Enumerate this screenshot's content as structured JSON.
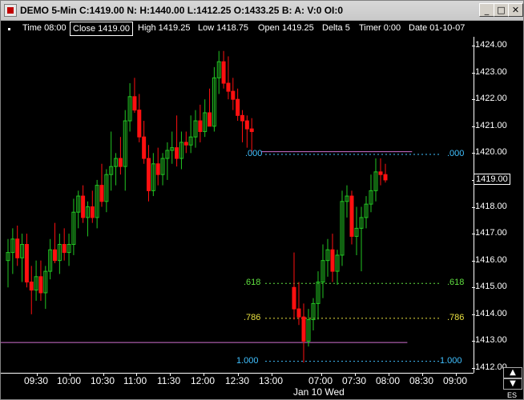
{
  "window": {
    "title": "DEMO 5-Min C:1419.00 N: H:1440.00 L:1412.25 O:1433.25 B: A: V:0 OI:0",
    "minimize": "_",
    "maximize": "□",
    "close": "✕"
  },
  "status": {
    "time": "Time 08:00",
    "close": "Close 1419.00",
    "high": "High 1419.25",
    "low": "Low 1418.75",
    "open": "Open 1419.25",
    "delta": "Delta 5",
    "timer": "Timer 0:00",
    "date": "Date 01-10-07"
  },
  "price_axis": {
    "ticks": [
      "1424.00",
      "1423.00",
      "1422.00",
      "1421.00",
      "1420.00",
      "1419.00",
      "1418.00",
      "1417.00",
      "1416.00",
      "1415.00",
      "1414.00",
      "1413.00",
      "1412.00"
    ],
    "current_price": "1419.00"
  },
  "time_axis": {
    "ticks": [
      "09:30",
      "10:00",
      "10:30",
      "11:00",
      "11:30",
      "12:00",
      "12:30",
      "13:00",
      "07:00",
      "07:30",
      "08:00",
      "08:30",
      "09:00"
    ],
    "date_label": "Jan 10 Wed",
    "symbol": "ES"
  },
  "fib": {
    "labels_left": [
      ".000",
      ".618",
      ".786",
      "1.000"
    ],
    "labels_right": [
      ".000",
      ".618",
      ".786",
      "1.000"
    ]
  },
  "colors": {
    "up": "#22c522",
    "down": "#ff1010",
    "fib0": "#40c0ff",
    "fib618": "#60e040",
    "fib786": "#e8e040",
    "fib1": "#40c0ff",
    "hline": "#d070d0"
  },
  "chart_data": {
    "type": "candlestick",
    "ylim": [
      1412,
      1424.2
    ],
    "candles": [
      {
        "o": 1416.0,
        "h": 1416.8,
        "l": 1415.0,
        "c": 1416.3
      },
      {
        "o": 1416.3,
        "h": 1417.2,
        "l": 1415.5,
        "c": 1416.8
      },
      {
        "o": 1416.8,
        "h": 1417.3,
        "l": 1415.8,
        "c": 1416.1
      },
      {
        "o": 1416.1,
        "h": 1417.0,
        "l": 1415.2,
        "c": 1416.6
      },
      {
        "o": 1416.6,
        "h": 1417.0,
        "l": 1415.0,
        "c": 1415.2
      },
      {
        "o": 1415.2,
        "h": 1415.8,
        "l": 1414.0,
        "c": 1414.9
      },
      {
        "o": 1414.9,
        "h": 1416.0,
        "l": 1414.5,
        "c": 1415.4
      },
      {
        "o": 1415.4,
        "h": 1416.0,
        "l": 1414.5,
        "c": 1414.8
      },
      {
        "o": 1414.8,
        "h": 1415.8,
        "l": 1414.2,
        "c": 1415.6
      },
      {
        "o": 1415.6,
        "h": 1416.8,
        "l": 1415.3,
        "c": 1416.4
      },
      {
        "o": 1416.4,
        "h": 1417.4,
        "l": 1415.9,
        "c": 1416.0
      },
      {
        "o": 1416.0,
        "h": 1417.0,
        "l": 1415.5,
        "c": 1416.6
      },
      {
        "o": 1416.6,
        "h": 1417.2,
        "l": 1416.0,
        "c": 1416.3
      },
      {
        "o": 1416.3,
        "h": 1417.0,
        "l": 1415.8,
        "c": 1416.6
      },
      {
        "o": 1416.6,
        "h": 1418.3,
        "l": 1416.2,
        "c": 1417.8
      },
      {
        "o": 1417.8,
        "h": 1418.6,
        "l": 1417.2,
        "c": 1418.4
      },
      {
        "o": 1418.4,
        "h": 1418.8,
        "l": 1417.4,
        "c": 1417.6
      },
      {
        "o": 1417.6,
        "h": 1418.2,
        "l": 1416.9,
        "c": 1418.0
      },
      {
        "o": 1418.0,
        "h": 1418.6,
        "l": 1417.4,
        "c": 1417.6
      },
      {
        "o": 1417.6,
        "h": 1419.0,
        "l": 1417.2,
        "c": 1418.8
      },
      {
        "o": 1418.8,
        "h": 1419.6,
        "l": 1418.0,
        "c": 1418.2
      },
      {
        "o": 1418.2,
        "h": 1419.4,
        "l": 1417.8,
        "c": 1419.2
      },
      {
        "o": 1419.2,
        "h": 1420.8,
        "l": 1418.6,
        "c": 1419.5
      },
      {
        "o": 1419.5,
        "h": 1420.0,
        "l": 1418.8,
        "c": 1419.8
      },
      {
        "o": 1419.8,
        "h": 1420.6,
        "l": 1419.2,
        "c": 1419.5
      },
      {
        "o": 1419.5,
        "h": 1421.6,
        "l": 1418.6,
        "c": 1421.2
      },
      {
        "o": 1421.2,
        "h": 1422.6,
        "l": 1420.8,
        "c": 1422.1
      },
      {
        "o": 1422.1,
        "h": 1422.8,
        "l": 1421.5,
        "c": 1421.6
      },
      {
        "o": 1421.6,
        "h": 1422.2,
        "l": 1420.4,
        "c": 1420.6
      },
      {
        "o": 1420.6,
        "h": 1421.2,
        "l": 1419.6,
        "c": 1419.8
      },
      {
        "o": 1419.8,
        "h": 1420.3,
        "l": 1418.2,
        "c": 1418.6
      },
      {
        "o": 1418.6,
        "h": 1420.0,
        "l": 1418.4,
        "c": 1419.6
      },
      {
        "o": 1419.6,
        "h": 1420.2,
        "l": 1418.8,
        "c": 1419.2
      },
      {
        "o": 1419.2,
        "h": 1420.0,
        "l": 1418.8,
        "c": 1419.8
      },
      {
        "o": 1419.8,
        "h": 1420.4,
        "l": 1419.0,
        "c": 1420.1
      },
      {
        "o": 1420.1,
        "h": 1420.8,
        "l": 1419.6,
        "c": 1420.2
      },
      {
        "o": 1420.2,
        "h": 1421.4,
        "l": 1419.5,
        "c": 1419.8
      },
      {
        "o": 1419.8,
        "h": 1420.8,
        "l": 1419.4,
        "c": 1420.4
      },
      {
        "o": 1420.4,
        "h": 1420.8,
        "l": 1420.0,
        "c": 1420.3
      },
      {
        "o": 1420.3,
        "h": 1421.4,
        "l": 1420.0,
        "c": 1420.6
      },
      {
        "o": 1420.6,
        "h": 1421.6,
        "l": 1420.2,
        "c": 1421.2
      },
      {
        "o": 1421.2,
        "h": 1421.8,
        "l": 1420.4,
        "c": 1420.8
      },
      {
        "o": 1420.8,
        "h": 1422.0,
        "l": 1420.6,
        "c": 1421.5
      },
      {
        "o": 1421.5,
        "h": 1422.4,
        "l": 1421.0,
        "c": 1421.0
      },
      {
        "o": 1421.0,
        "h": 1423.2,
        "l": 1420.8,
        "c": 1422.8
      },
      {
        "o": 1422.8,
        "h": 1423.8,
        "l": 1422.2,
        "c": 1423.4
      },
      {
        "o": 1423.4,
        "h": 1423.8,
        "l": 1422.4,
        "c": 1422.6
      },
      {
        "o": 1422.6,
        "h": 1423.6,
        "l": 1422.0,
        "c": 1422.3
      },
      {
        "o": 1422.3,
        "h": 1422.8,
        "l": 1421.6,
        "c": 1422.0
      },
      {
        "o": 1422.0,
        "h": 1422.4,
        "l": 1421.2,
        "c": 1421.4
      },
      {
        "o": 1421.4,
        "h": 1421.6,
        "l": 1420.4,
        "c": 1421.2
      },
      {
        "o": 1421.2,
        "h": 1421.4,
        "l": 1420.2,
        "c": 1420.9
      },
      {
        "o": 1420.9,
        "h": 1421.3,
        "l": 1420.0,
        "c": 1420.8
      },
      {
        "o": 1415.0,
        "h": 1416.3,
        "l": 1413.8,
        "c": 1414.2
      },
      {
        "o": 1414.2,
        "h": 1415.2,
        "l": 1413.6,
        "c": 1413.9
      },
      {
        "o": 1413.9,
        "h": 1414.4,
        "l": 1412.2,
        "c": 1413.0
      },
      {
        "o": 1413.0,
        "h": 1414.2,
        "l": 1412.8,
        "c": 1413.8
      },
      {
        "o": 1413.8,
        "h": 1414.6,
        "l": 1413.4,
        "c": 1414.4
      },
      {
        "o": 1414.4,
        "h": 1415.6,
        "l": 1413.8,
        "c": 1415.2
      },
      {
        "o": 1415.2,
        "h": 1416.6,
        "l": 1414.6,
        "c": 1416.0
      },
      {
        "o": 1416.0,
        "h": 1416.8,
        "l": 1415.4,
        "c": 1416.4
      },
      {
        "o": 1416.4,
        "h": 1417.0,
        "l": 1415.2,
        "c": 1415.6
      },
      {
        "o": 1415.6,
        "h": 1416.4,
        "l": 1415.1,
        "c": 1416.2
      },
      {
        "o": 1416.2,
        "h": 1418.6,
        "l": 1415.8,
        "c": 1418.2
      },
      {
        "o": 1418.2,
        "h": 1418.8,
        "l": 1417.6,
        "c": 1418.4
      },
      {
        "o": 1418.4,
        "h": 1418.6,
        "l": 1416.6,
        "c": 1416.9
      },
      {
        "o": 1416.9,
        "h": 1418.0,
        "l": 1416.2,
        "c": 1417.2
      },
      {
        "o": 1417.2,
        "h": 1418.0,
        "l": 1415.6,
        "c": 1417.6
      },
      {
        "o": 1417.6,
        "h": 1418.4,
        "l": 1417.2,
        "c": 1418.1
      },
      {
        "o": 1418.1,
        "h": 1419.2,
        "l": 1417.8,
        "c": 1418.6
      },
      {
        "o": 1418.6,
        "h": 1419.8,
        "l": 1418.2,
        "c": 1419.3
      },
      {
        "o": 1419.3,
        "h": 1419.8,
        "l": 1418.8,
        "c": 1419.2
      },
      {
        "o": 1419.2,
        "h": 1419.6,
        "l": 1418.9,
        "c": 1419.0
      }
    ],
    "hlines": [
      {
        "value": 1420.05,
        "color_key": "hline",
        "from": 0.55,
        "to": 0.87
      },
      {
        "value": 1412.95,
        "color_key": "hline",
        "from": 0.0,
        "to": 0.86
      }
    ],
    "fib_levels": [
      {
        "label": ".000",
        "value": 1419.95,
        "color_key": "fib0"
      },
      {
        "label": ".618",
        "value": 1415.15,
        "color_key": "fib618"
      },
      {
        "label": ".786",
        "value": 1413.85,
        "color_key": "fib786"
      },
      {
        "label": "1.000",
        "value": 1412.25,
        "color_key": "fib1"
      }
    ]
  }
}
